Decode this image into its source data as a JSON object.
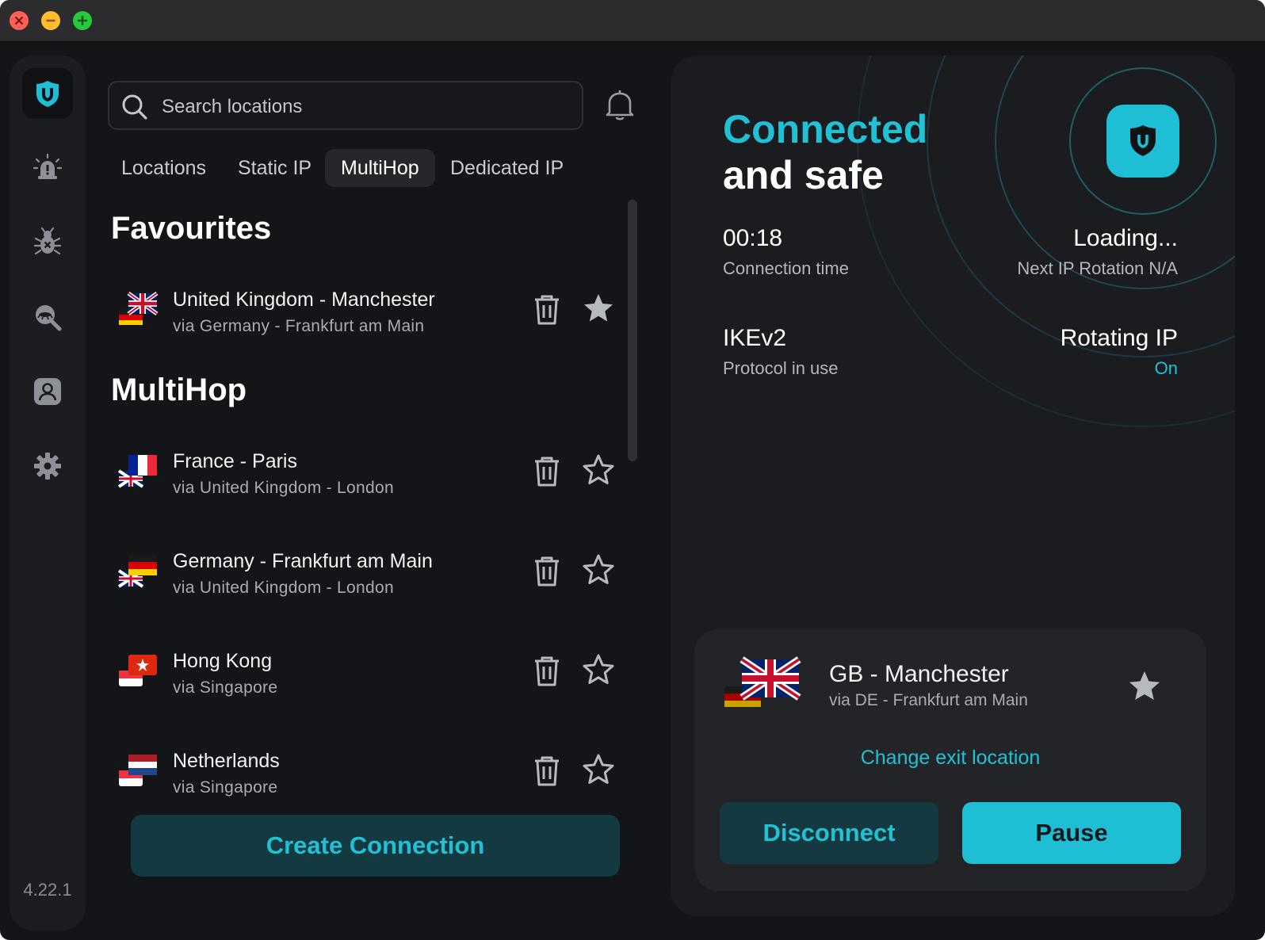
{
  "window": {
    "controls": [
      "close",
      "minimize",
      "maximize"
    ]
  },
  "sidebar": {
    "items": [
      {
        "icon": "shield-logo-icon"
      },
      {
        "icon": "alarm-icon"
      },
      {
        "icon": "bug-icon"
      },
      {
        "icon": "search-eye-icon"
      },
      {
        "icon": "account-icon"
      },
      {
        "icon": "settings-gear-icon"
      }
    ],
    "version": "4.22.1"
  },
  "search": {
    "placeholder": "Search locations"
  },
  "tabs": [
    {
      "label": "Locations",
      "active": false
    },
    {
      "label": "Static IP",
      "active": false
    },
    {
      "label": "MultiHop",
      "active": true
    },
    {
      "label": "Dedicated IP",
      "active": false
    }
  ],
  "sections": {
    "favourites": "Favourites",
    "multihop": "MultiHop"
  },
  "favourites": [
    {
      "name": "United Kingdom - Manchester",
      "via": "via Germany - Frankfurt am Main",
      "starred": true
    }
  ],
  "multihop": [
    {
      "name": "France - Paris",
      "via": "via United Kingdom - London",
      "starred": false
    },
    {
      "name": "Germany - Frankfurt am Main",
      "via": "via United Kingdom - London",
      "starred": false
    },
    {
      "name": "Hong Kong",
      "via": "via Singapore",
      "starred": false
    },
    {
      "name": "Netherlands",
      "via": "via Singapore",
      "starred": false
    }
  ],
  "create_button": "Create Connection",
  "status": {
    "line1": "Connected",
    "line2": "and safe",
    "time_value": "00:18",
    "time_label": "Connection time",
    "rotation_value": "Loading...",
    "rotation_label": "Next IP Rotation N/A",
    "protocol_value": "IKEv2",
    "protocol_label": "Protocol in use",
    "rotating_value": "Rotating IP",
    "rotating_label": "On"
  },
  "connection": {
    "name": "GB - Manchester",
    "via": "via DE - Frankfurt am Main",
    "change_exit": "Change exit location",
    "disconnect": "Disconnect",
    "pause": "Pause"
  },
  "colors": {
    "accent": "#1ebfd5",
    "background": "#141518",
    "panel": "#1b1c20"
  }
}
